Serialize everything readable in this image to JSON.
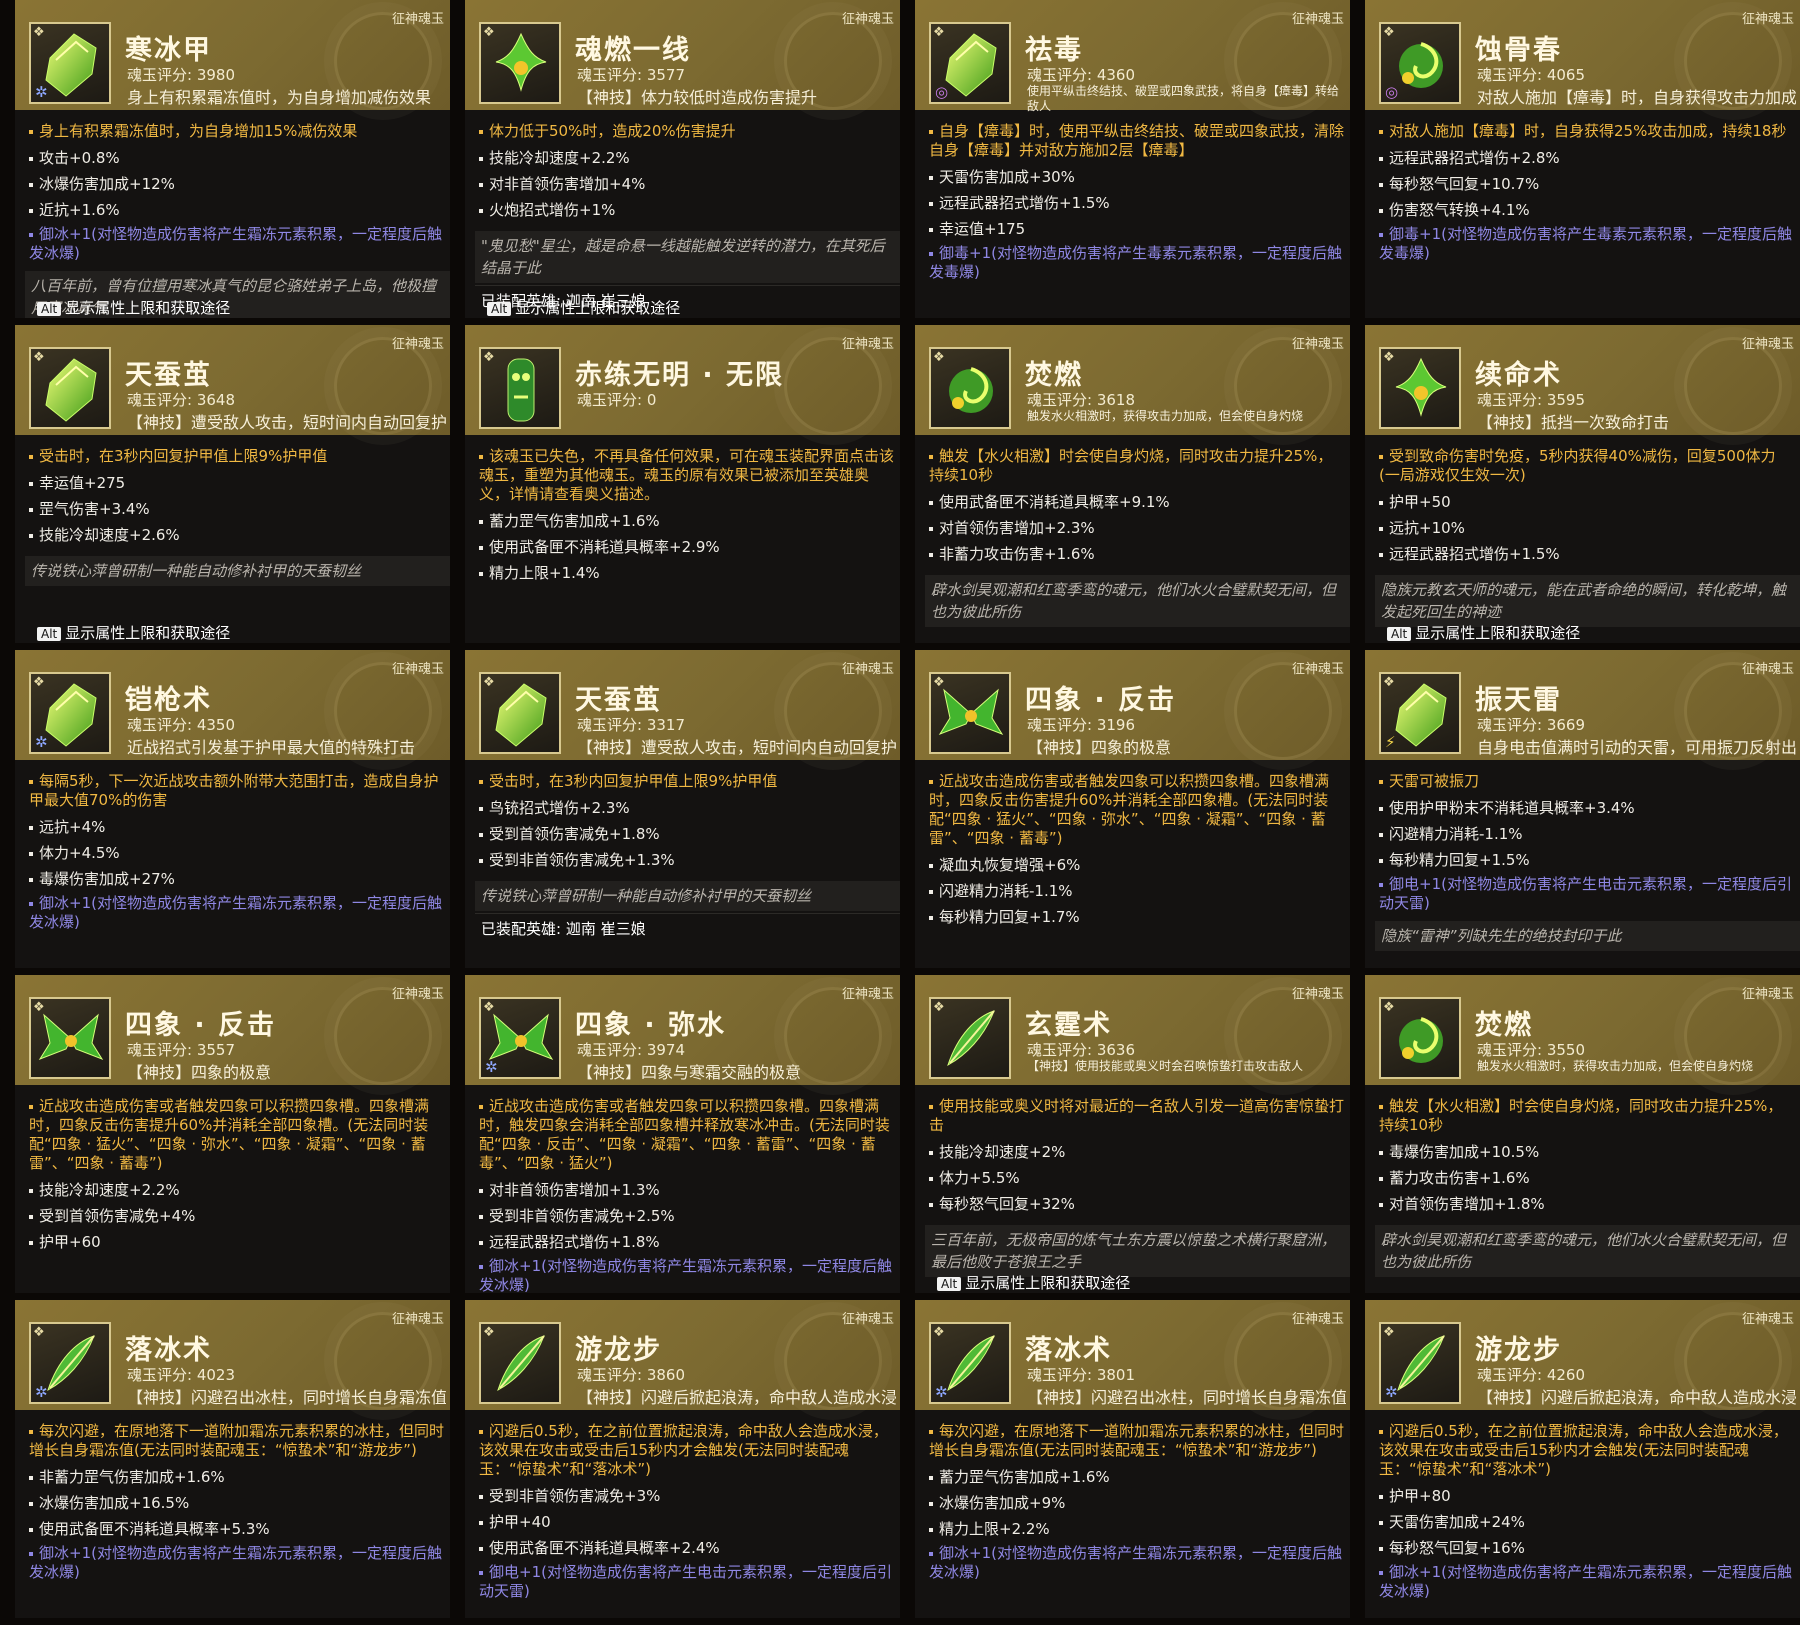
{
  "labels": {
    "tag": "征神魂玉",
    "alt_key": "Alt",
    "alt_text": "显示属性上限和获取途径",
    "equipped_prefix": "已装配英雄: "
  },
  "cards": [
    {
      "id": "c1",
      "name": "寒冰甲",
      "score": "魂玉评分: 3980",
      "sub": "身上有积累霜冻值时，为自身增加减伤效果",
      "icon": "gem-icon",
      "elem": "ice",
      "main": "身上有积累霜冻值时，为自身增加15%减伤效果",
      "stats": [
        "攻击+0.8%",
        "冰爆伤害加成+12%",
        "近抗+1.6%"
      ],
      "special": "御冰+1(对怪物造成伤害将产生霜冻元素积累，一定程度后触发冰爆)",
      "lore": "八百年前，曾有位擅用寒冰真气的昆仑骆姓弟子上岛，他极擅用寒冰真气",
      "alt": true
    },
    {
      "id": "c2",
      "name": "魂燃一线",
      "score": "魂玉评分: 3577",
      "sub": "【神技】体力较低时造成伤害提升",
      "icon": "flower-icon",
      "main": "体力低于50%时，造成20%伤害提升",
      "stats": [
        "技能冷却速度+2.2%",
        "对非首领伤害增加+4%",
        "火炮招式增伤+1%"
      ],
      "lore": "\"鬼见愁\"星尘，越是命悬一线越能触发逆转的潜力，在其死后结晶于此",
      "hero": "迦南 崔三娘",
      "alt": true
    },
    {
      "id": "c3",
      "name": "祛毒",
      "score": "魂玉评分: 4360",
      "sub": "使用平纵击终结技、破罡或四象武技，将自身【瘴毒】转给敌人",
      "sub_small": true,
      "icon": "gem-icon",
      "elem": "poison",
      "main": "自身【瘴毒】时，使用平纵击终结技、破罡或四象武技，清除自身【瘴毒】并对敌方施加2层【瘴毒】",
      "stats": [
        "天雷伤害加成+30%",
        "远程武器招式增伤+1.5%",
        "幸运值+175"
      ],
      "special": "御毒+1(对怪物造成伤害将产生毒素元素积累，一定程度后触发毒爆)"
    },
    {
      "id": "c4",
      "name": "蚀骨春",
      "score": "魂玉评分: 4065",
      "sub": "对敌人施加【瘴毒】时，自身获得攻击力加成",
      "icon": "swirl-icon",
      "elem": "poison",
      "main": "对敌人施加【瘴毒】时，自身获得25%攻击加成，持续18秒",
      "stats": [
        "远程武器招式增伤+2.8%",
        "每秒怒气回复+10.7%",
        "伤害怒气转换+4.1%"
      ],
      "special": "御毒+1(对怪物造成伤害将产生毒素元素积累，一定程度后触发毒爆)"
    },
    {
      "id": "c5",
      "name": "天蚕茧",
      "score": "魂玉评分: 3648",
      "sub": "【神技】遭受敌人攻击，短时间内自动回复护甲值",
      "icon": "gem-icon",
      "main": "受击时，在3秒内回复护甲值上限9%护甲值",
      "stats": [
        "幸运值+275",
        "罡气伤害+3.4%",
        "技能冷却速度+2.6%"
      ],
      "lore": "传说铁心萍曾研制一种能自动修补衬甲的天蚕韧丝",
      "alt": true
    },
    {
      "id": "c6",
      "name": "赤练无明 · 无限",
      "score": "魂玉评分: 0",
      "sub": "",
      "icon": "totem-icon",
      "main": "该魂玉已失色，不再具备任何效果，可在魂玉装配界面点击该魂玉，重塑为其他魂玉。魂玉的原有效果已被添加至英雄奥义，详情请查看奥义描述。",
      "stats": [
        "蓄力罡气伤害加成+1.6%",
        "使用武备匣不消耗道具概率+2.9%",
        "精力上限+1.4%"
      ]
    },
    {
      "id": "c7",
      "name": "焚燃",
      "score": "魂玉评分: 3618",
      "sub": "触发水火相激时，获得攻击力加成，但会使自身灼烧",
      "sub_small": true,
      "icon": "swirl-icon",
      "main": "触发【水火相激】时会使自身灼烧，同时攻击力提升25%，持续10秒",
      "stats": [
        "使用武备匣不消耗道具概率+9.1%",
        "对首领伤害增加+2.3%",
        "非蓄力攻击伤害+1.6%"
      ],
      "lore": "辟水剑昊观潮和红鸾季鸾的魂元，他们水火合璧默契无间，但也为彼此所伤"
    },
    {
      "id": "c8",
      "name": "续命术",
      "score": "魂玉评分: 3595",
      "sub": "【神技】抵挡一次致命打击",
      "icon": "flower-icon",
      "main": "受到致命伤害时免疫，5秒内获得40%减伤，回复500体力(一局游戏仅生效一次)",
      "stats": [
        "护甲+50",
        "远抗+10%",
        "远程武器招式增伤+1.5%"
      ],
      "lore": "隐族元教玄天师的魂元，能在武者命绝的瞬间，转化乾坤，触发起死回生的神迹",
      "alt": true
    },
    {
      "id": "c9",
      "name": "铠枪术",
      "score": "魂玉评分: 4350",
      "sub": "近战招式引发基于护甲最大值的特殊打击",
      "icon": "gem-icon",
      "elem": "ice",
      "main": "每隔5秒，下一次近战攻击额外附带大范围打击，造成自身护甲最大值70%的伤害",
      "stats": [
        "远抗+4%",
        "体力+4.5%",
        "毒爆伤害加成+27%"
      ],
      "special": "御冰+1(对怪物造成伤害将产生霜冻元素积累，一定程度后触发冰爆)"
    },
    {
      "id": "c10",
      "name": "天蚕茧",
      "score": "魂玉评分: 3317",
      "sub": "【神技】遭受敌人攻击，短时间内自动回复护甲值",
      "icon": "gem-icon",
      "main": "受击时，在3秒内回复护甲值上限9%护甲值",
      "stats": [
        "鸟铳招式增伤+2.3%",
        "受到首领伤害减免+1.8%",
        "受到非首领伤害减免+1.3%"
      ],
      "lore": "传说铁心萍曾研制一种能自动修补衬甲的天蚕韧丝",
      "hero": "迦南 崔三娘"
    },
    {
      "id": "c11",
      "name": "四象 · 反击",
      "score": "魂玉评分: 3196",
      "sub": "【神技】四象的极意",
      "icon": "wings-icon",
      "main": "近战攻击造成伤害或者触发四象可以积攒四象槽。四象槽满时，四象反击伤害提升60%并消耗全部四象槽。(无法同时装配“四象 · 猛火”、“四象 · 弥水”、“四象 · 凝霜”、“四象 · 蓄雷”、“四象 · 蓄毒”)",
      "stats": [
        "凝血丸恢复增强+6%",
        "闪避精力消耗-1.1%",
        "每秒精力回复+1.7%"
      ]
    },
    {
      "id": "c12",
      "name": "振天雷",
      "score": "魂玉评分: 3669",
      "sub": "自身电击值满时引动的天雷，可用振刀反射出去",
      "icon": "gem-icon",
      "elem": "thunder",
      "main": "天雷可被振刀",
      "stats": [
        "使用护甲粉末不消耗道具概率+3.4%",
        "闪避精力消耗-1.1%",
        "每秒精力回复+1.5%"
      ],
      "special": "御电+1(对怪物造成伤害将产生电击元素积累，一定程度后引动天雷)",
      "lore": "隐族“雷神”列缺先生的绝技封印于此"
    },
    {
      "id": "c13",
      "name": "四象 · 反击",
      "score": "魂玉评分: 3557",
      "sub": "【神技】四象的极意",
      "icon": "wings-icon",
      "main": "近战攻击造成伤害或者触发四象可以积攒四象槽。四象槽满时，四象反击伤害提升60%并消耗全部四象槽。(无法同时装配“四象 · 猛火”、“四象 · 弥水”、“四象 · 凝霜”、“四象 · 蓄雷”、“四象 · 蓄毒”)",
      "stats": [
        "技能冷却速度+2.2%",
        "受到首领伤害减免+4%",
        "护甲+60"
      ]
    },
    {
      "id": "c14",
      "name": "四象 · 弥水",
      "score": "魂玉评分: 3974",
      "sub": "【神技】四象与寒霜交融的极意",
      "icon": "wings-icon",
      "elem": "ice",
      "main": "近战攻击造成伤害或者触发四象可以积攒四象槽。四象槽满时，触发四象会消耗全部四象槽并释放寒冰冲击。(无法同时装配“四象 · 反击”、“四象 · 凝霜”、“四象 · 蓄雷”、“四象 · 蓄毒”、“四象 · 猛火”)",
      "stats": [
        "对非首领伤害增加+1.3%",
        "受到非首领伤害减免+2.5%",
        "远程武器招式增伤+1.8%"
      ],
      "special": "御冰+1(对怪物造成伤害将产生霜冻元素积累，一定程度后触发冰爆)"
    },
    {
      "id": "c15",
      "name": "玄霆术",
      "score": "魂玉评分: 3636",
      "sub": "【神技】使用技能或奥义时会召唤惊蛰打击攻击敌人",
      "sub_small": true,
      "icon": "feather-icon",
      "main": "使用技能或奥义时将对最近的一名敌人引发一道高伤害惊蛰打击",
      "stats": [
        "技能冷却速度+2%",
        "体力+5.5%",
        "每秒怒气回复+32%"
      ],
      "lore": "三百年前，无极帝国的炼气士东方震以惊蛰之术横行聚窟洲，最后他败于苍狼王之手",
      "alt": true
    },
    {
      "id": "c16",
      "name": "焚燃",
      "score": "魂玉评分: 3550",
      "sub": "触发水火相激时，获得攻击力加成，但会使自身灼烧",
      "sub_small": true,
      "icon": "swirl-icon",
      "main": "触发【水火相激】时会使自身灼烧，同时攻击力提升25%，持续10秒",
      "stats": [
        "毒爆伤害加成+10.5%",
        "蓄力攻击伤害+1.6%",
        "对首领伤害增加+1.8%"
      ],
      "lore": "辟水剑昊观潮和红鸾季鸾的魂元，他们水火合璧默契无间，但也为彼此所伤"
    },
    {
      "id": "c17",
      "name": "落冰术",
      "score": "魂玉评分: 4023",
      "sub": "【神技】闪避召出冰柱，同时增长自身霜冻值",
      "icon": "feather-icon",
      "elem": "ice",
      "main": "每次闪避，在原地落下一道附加霜冻元素积累的冰柱，但同时增长自身霜冻值(无法同时装配魂玉：“惊蛰术”和“游龙步”)",
      "stats": [
        "非蓄力罡气伤害加成+1.6%",
        "冰爆伤害加成+16.5%",
        "使用武备匣不消耗道具概率+5.3%"
      ],
      "special": "御冰+1(对怪物造成伤害将产生霜冻元素积累，一定程度后触发冰爆)"
    },
    {
      "id": "c18",
      "name": "游龙步",
      "score": "魂玉评分: 3860",
      "sub": "【神技】闪避后掀起浪涛，命中敌人造成水浸",
      "icon": "feather-icon",
      "main": "闪避后0.5秒，在之前位置掀起浪涛，命中敌人会造成水浸，该效果在攻击或受击后15秒内才会触发(无法同时装配魂玉：“惊蛰术”和“落冰术”)",
      "stats": [
        "受到非首领伤害减免+3%",
        "护甲+40",
        "使用武备匣不消耗道具概率+2.4%"
      ],
      "special": "御电+1(对怪物造成伤害将产生电击元素积累，一定程度后引动天雷)"
    },
    {
      "id": "c19",
      "name": "落冰术",
      "score": "魂玉评分: 3801",
      "sub": "【神技】闪避召出冰柱，同时增长自身霜冻值",
      "icon": "feather-icon",
      "elem": "ice",
      "main": "每次闪避，在原地落下一道附加霜冻元素积累的冰柱，但同时增长自身霜冻值(无法同时装配魂玉：“惊蛰术”和“游龙步”)",
      "stats": [
        "蓄力罡气伤害加成+1.6%",
        "冰爆伤害加成+9%",
        "精力上限+2.2%"
      ],
      "special": "御冰+1(对怪物造成伤害将产生霜冻元素积累，一定程度后触发冰爆)"
    },
    {
      "id": "c20",
      "name": "游龙步",
      "score": "魂玉评分: 4260",
      "sub": "【神技】闪避后掀起浪涛，命中敌人造成水浸",
      "icon": "feather-icon",
      "elem": "ice",
      "main": "闪避后0.5秒，在之前位置掀起浪涛，命中敌人会造成水浸，该效果在攻击或受击后15秒内才会触发(无法同时装配魂玉：“惊蛰术”和“落冰术”)",
      "stats": [
        "护甲+80",
        "天雷伤害加成+24%",
        "每秒怒气回复+16%"
      ],
      "special": "御冰+1(对怪物造成伤害将产生霜冻元素积累，一定程度后触发冰爆)"
    }
  ]
}
